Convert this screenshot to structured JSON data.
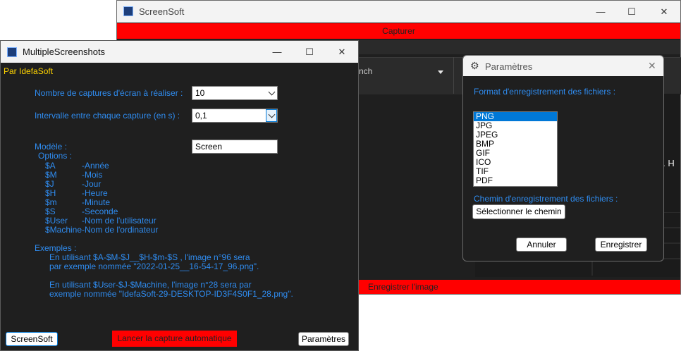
{
  "screensoft": {
    "title": "ScreenSoft",
    "capture_label": "Capturer",
    "search_text": "nch",
    "partial_text": "ory. H",
    "save_label": "Enregistrer l'image",
    "minimize": "—",
    "maximize": "☐",
    "close": "✕"
  },
  "multiple": {
    "title": "MultipleScreenshots",
    "byline": "Par IdefaSoft",
    "count_label": "Nombre de captures d'écran  à réaliser :",
    "count_value": "10",
    "interval_label": "Intervalle entre chaque capture (en s) :",
    "interval_value": "0,1",
    "model_label": "Modèle :",
    "model_value": "Screen",
    "options_label": "Options :",
    "options": [
      {
        "code": "$A",
        "desc": "-Année"
      },
      {
        "code": "$M",
        "desc": "-Mois"
      },
      {
        "code": "$J",
        "desc": "-Jour"
      },
      {
        "code": "$H",
        "desc": "-Heure"
      },
      {
        "code": "$m",
        "desc": "-Minute"
      },
      {
        "code": "$S",
        "desc": "-Seconde"
      },
      {
        "code": "$User",
        "desc": "-Nom de l'utilisateur"
      },
      {
        "code": "$Machine",
        "desc": "-Nom de l'ordinateur"
      }
    ],
    "examples_label": "Exemples :",
    "example1_line1": "En utilisant $A-$M-$J__$H-$m-$S , l'image n°96 sera",
    "example1_line2": "par exemple nommée \"2022-01-25__16-54-17_96.png\".",
    "example2_line1": "En utilisant $User-$J-$Machine, l'image n°28 sera par",
    "example2_line2": "exemple nommée \"IdefaSoft-29-DESKTOP-ID3F4S0F1_28.png\".",
    "screensoft_btn": "ScreenSoft",
    "launch_btn": "Lancer la capture automatique",
    "params_btn": "Paramètres",
    "minimize": "—",
    "maximize": "☐",
    "close": "✕"
  },
  "params": {
    "title": "Paramètres",
    "format_label": "Format d'enregistrement des fichiers :",
    "formats": [
      "PNG",
      "JPG",
      "JPEG",
      "BMP",
      "GIF",
      "ICO",
      "TIF",
      "PDF"
    ],
    "selected_format": "PNG",
    "path_label": "Chemin d'enregistrement des fichiers :",
    "path_btn": "Sélectionner le chemin",
    "cancel_btn": "Annuler",
    "save_btn": "Enregistrer",
    "close": "✕"
  },
  "colors": {
    "accent_blue": "#2f8cf0",
    "byline_yellow": "#ffd400",
    "red_button": "#ff0000",
    "selection_blue": "#0078d7"
  }
}
